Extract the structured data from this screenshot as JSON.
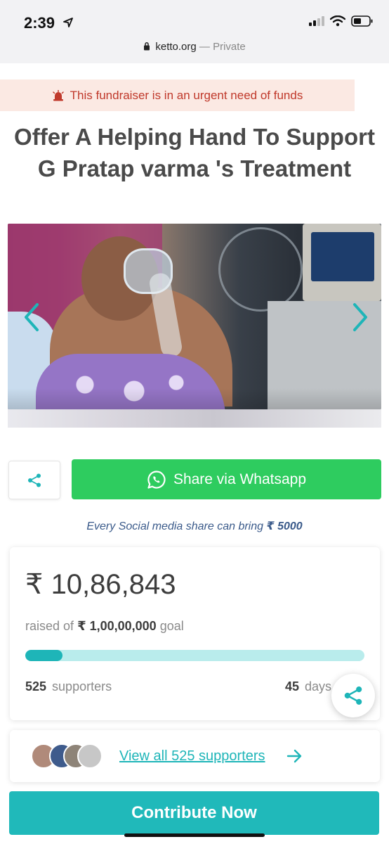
{
  "status_bar": {
    "time": "2:39",
    "url": "ketto.org",
    "url_suffix": "— Private"
  },
  "urgent_banner": {
    "text": "This fundraiser is in an urgent need of funds",
    "color": "#c0392b"
  },
  "title": "Offer A Helping Hand To Support G Pratap varma 's Treatment",
  "share": {
    "whatsapp_label": "Share via Whatsapp",
    "note_prefix": "Every Social media share can bring",
    "note_amount": "₹ 5000"
  },
  "funding": {
    "raised": "₹ 10,86,843",
    "goal_prefix": "raised of",
    "goal_amount": "₹ 1,00,00,000",
    "goal_suffix": "goal",
    "progress_fraction": 0.109,
    "supporters_count": "525",
    "supporters_label": "supporters",
    "days_count": "45",
    "days_label": "days"
  },
  "supporters_link": {
    "text": "View all 525 supporters"
  },
  "cta": {
    "label": "Contribute Now"
  },
  "colors": {
    "accent": "#1eb5b8",
    "whatsapp": "#2ecc5f",
    "cta": "#20b9ba"
  }
}
